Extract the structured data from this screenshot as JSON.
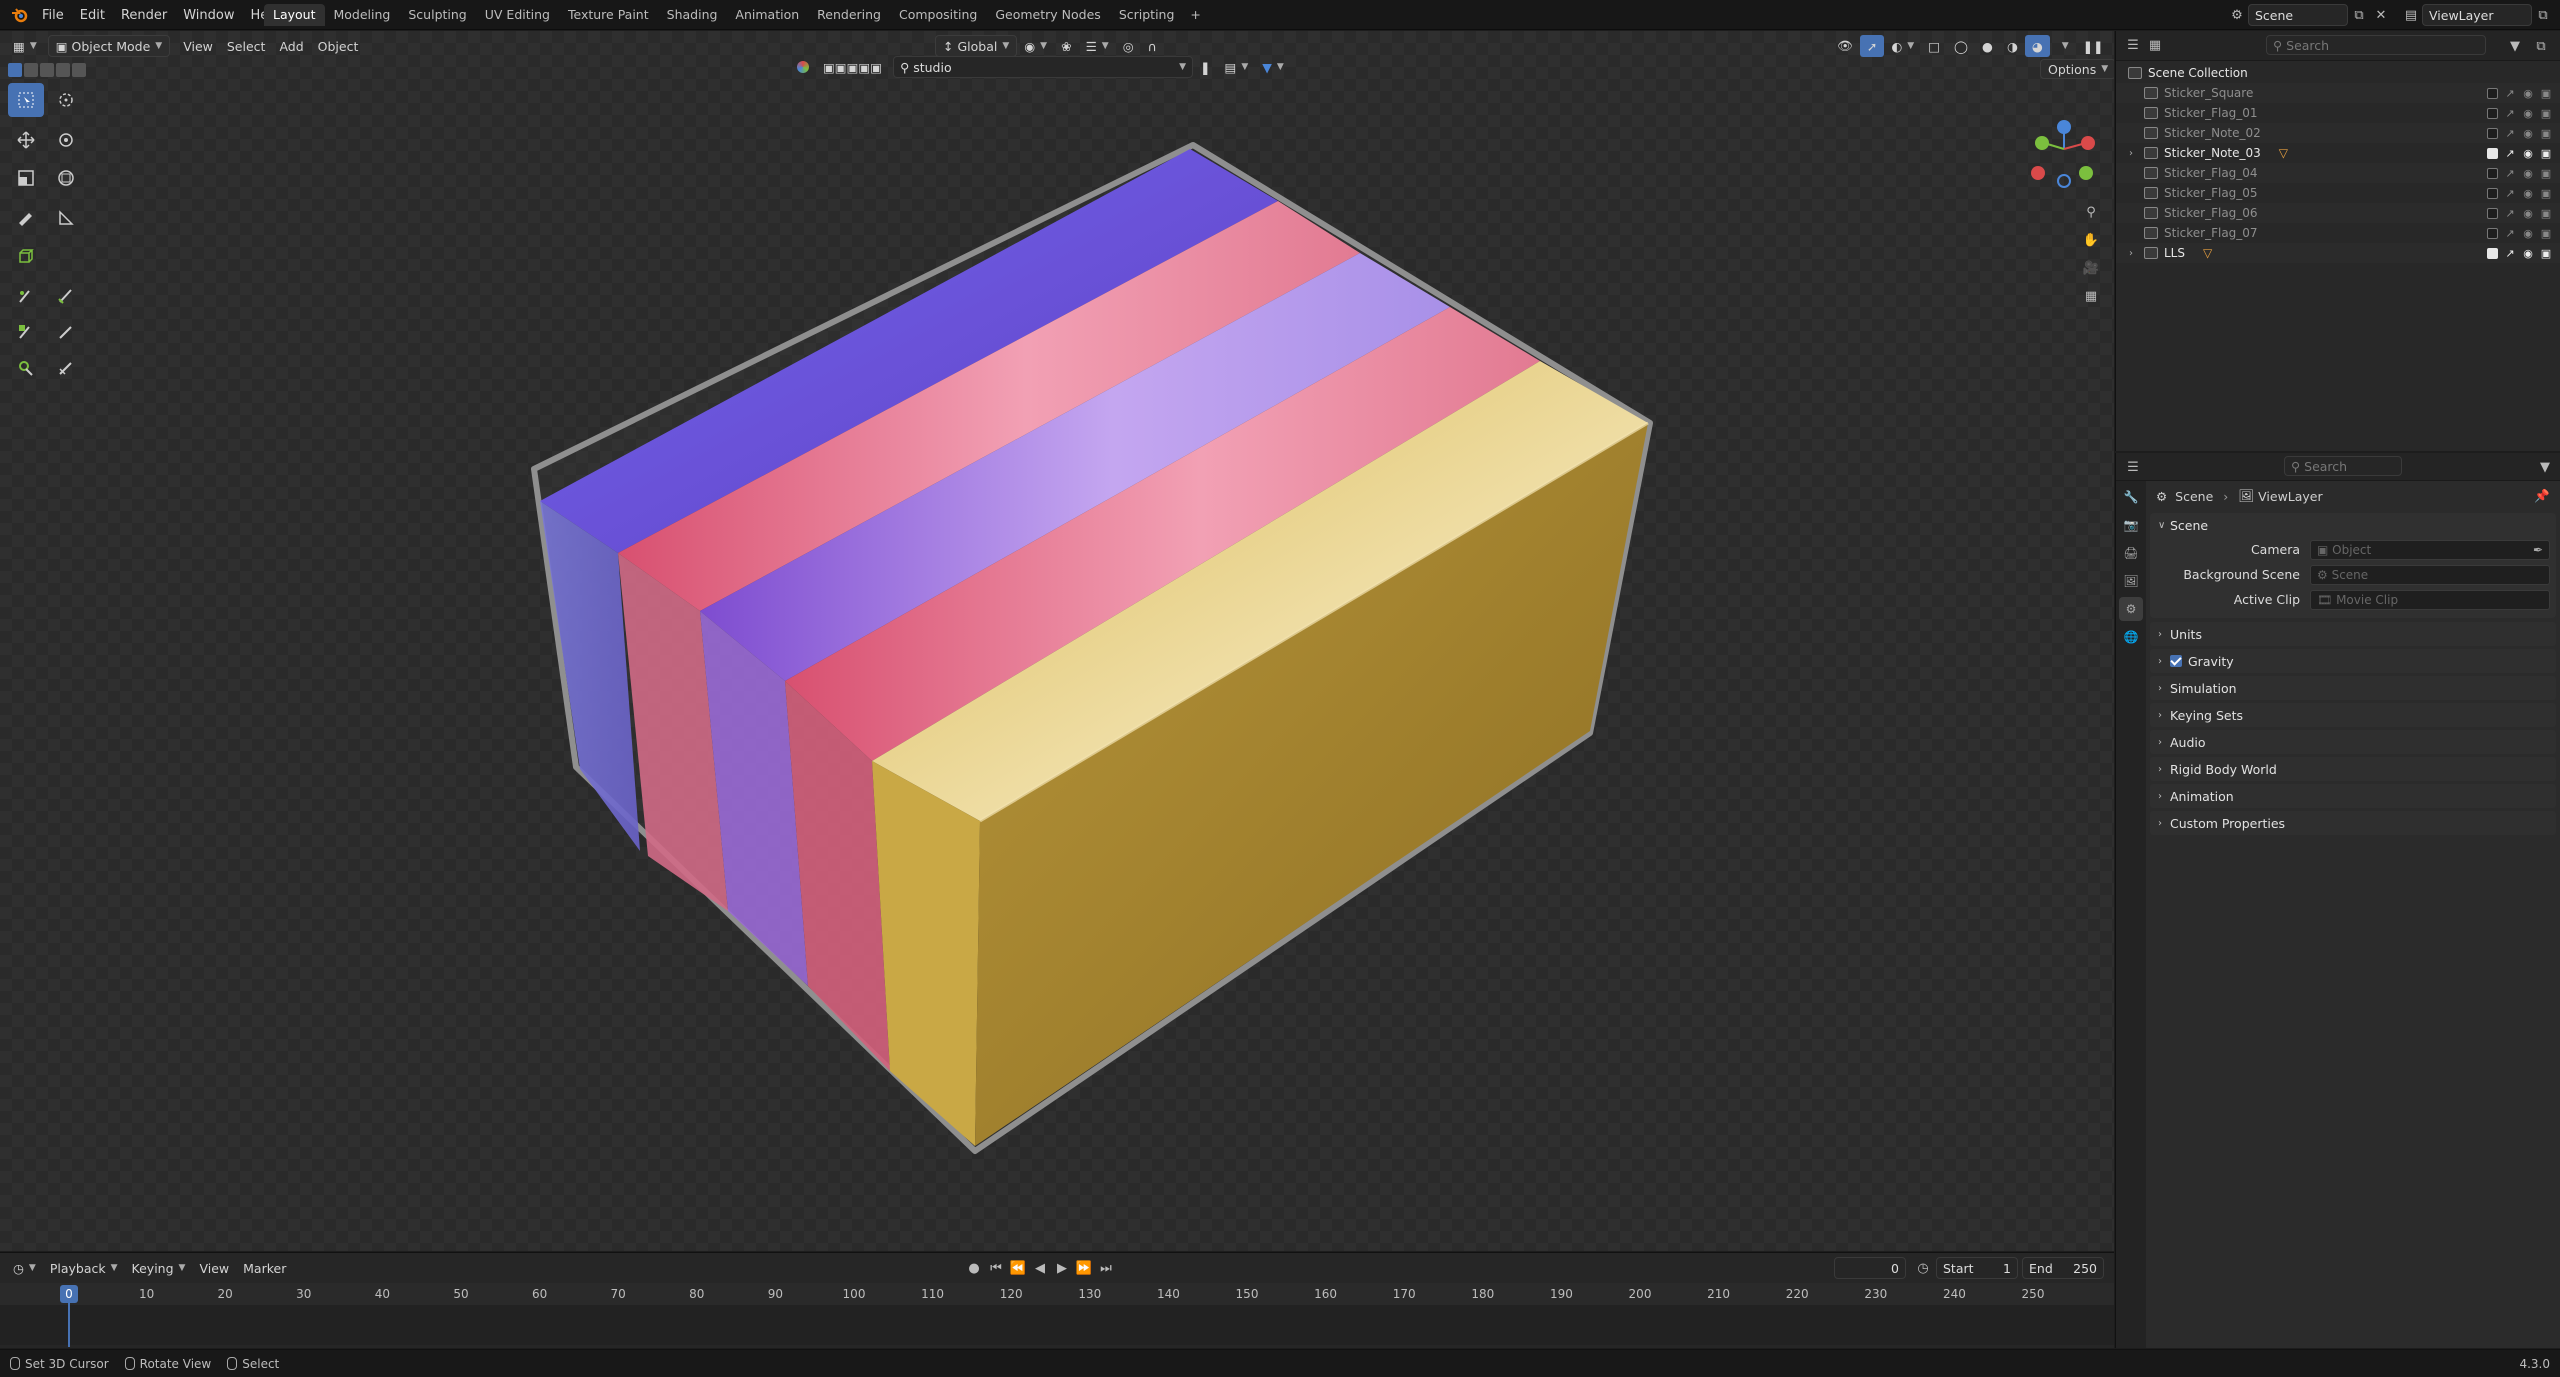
{
  "menubar": {
    "items": [
      "File",
      "Edit",
      "Render",
      "Window",
      "Help"
    ],
    "workspaces": [
      "Layout",
      "Modeling",
      "Sculpting",
      "UV Editing",
      "Texture Paint",
      "Shading",
      "Animation",
      "Rendering",
      "Compositing",
      "Geometry Nodes",
      "Scripting"
    ],
    "active_workspace": "Layout",
    "scene_name": "Scene",
    "view_layer": "ViewLayer"
  },
  "viewport_header": {
    "mode": "Object Mode",
    "menus": [
      "View",
      "Select",
      "Add",
      "Object"
    ],
    "orientation": "Global",
    "options_label": "Options",
    "search_value": "studio"
  },
  "toolbar": {
    "tools": [
      "select-box",
      "cursor",
      "move",
      "rotate",
      "scale",
      "transform",
      "annotate",
      "measure",
      "add-cube",
      "grease-draw",
      "grease-erase",
      "grease-fill",
      "grease-tint",
      "grease-sample",
      "grease-line"
    ]
  },
  "outliner": {
    "search_placeholder": "Search",
    "root": "Scene Collection",
    "items": [
      {
        "name": "Sticker_Square",
        "visible": false,
        "expandable": false
      },
      {
        "name": "Sticker_Flag_01",
        "visible": false,
        "expandable": false
      },
      {
        "name": "Sticker_Note_02",
        "visible": false,
        "expandable": false
      },
      {
        "name": "Sticker_Note_03",
        "visible": true,
        "expandable": true
      },
      {
        "name": "Sticker_Flag_04",
        "visible": false,
        "expandable": false
      },
      {
        "name": "Sticker_Flag_05",
        "visible": false,
        "expandable": false
      },
      {
        "name": "Sticker_Flag_06",
        "visible": false,
        "expandable": false
      },
      {
        "name": "Sticker_Flag_07",
        "visible": false,
        "expandable": false
      },
      {
        "name": "LLS",
        "visible": true,
        "expandable": true
      }
    ]
  },
  "properties": {
    "search_placeholder": "Search",
    "breadcrumb": [
      "Scene",
      "ViewLayer"
    ],
    "panel_title": "Scene",
    "fields": [
      {
        "label": "Camera",
        "placeholder": "Object"
      },
      {
        "label": "Background Scene",
        "placeholder": "Scene"
      },
      {
        "label": "Active Clip",
        "placeholder": "Movie Clip"
      }
    ],
    "subpanels": [
      "Units",
      "Gravity",
      "Simulation",
      "Keying Sets",
      "Audio",
      "Rigid Body World",
      "Animation",
      "Custom Properties"
    ]
  },
  "timeline": {
    "menus": [
      "Playback",
      "Keying",
      "View",
      "Marker"
    ],
    "current_frame": "0",
    "start_label": "Start",
    "start": "1",
    "end_label": "End",
    "end": "250",
    "ticks": [
      "10",
      "20",
      "30",
      "40",
      "50",
      "60",
      "70",
      "80",
      "90",
      "100",
      "110",
      "120",
      "130",
      "140",
      "150",
      "160",
      "170",
      "180",
      "190",
      "200",
      "210",
      "220",
      "230",
      "240",
      "250"
    ],
    "playhead_label": "0"
  },
  "statusbar": {
    "items": [
      "Set 3D Cursor",
      "Rotate View",
      "Select"
    ],
    "version": "4.3.0"
  },
  "colors": {
    "accent": "#4772b3",
    "stripe_blue": "#5a52d6",
    "stripe_pink": "#e06e8a",
    "stripe_violet": "#8a6ad8",
    "stripe_yellow": "#c9a845",
    "axis_x": "#d94a4a",
    "axis_y": "#7bbf3e",
    "axis_z": "#4a86d9"
  }
}
